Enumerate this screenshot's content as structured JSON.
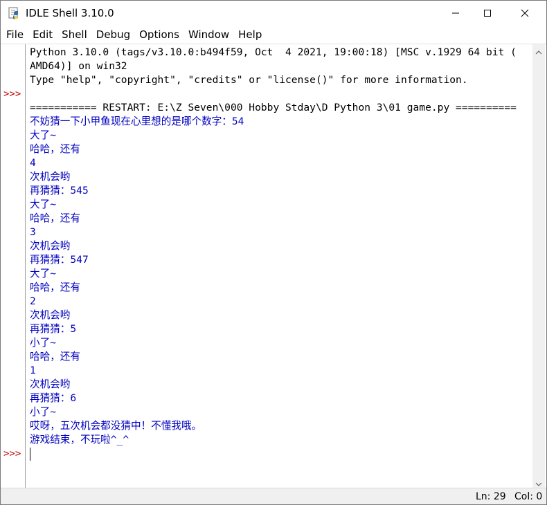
{
  "window": {
    "title": "IDLE Shell 3.10.0"
  },
  "menu": {
    "items": [
      "File",
      "Edit",
      "Shell",
      "Debug",
      "Options",
      "Window",
      "Help"
    ]
  },
  "gutter": {
    "prompt": ">>>"
  },
  "shell": {
    "lines": [
      {
        "text": "Python 3.10.0 (tags/v3.10.0:b494f59, Oct  4 2021, 19:00:18) [MSC v.1929 64 bit (",
        "kind": "stdout-black"
      },
      {
        "text": "AMD64)] on win32",
        "kind": "stdout-black"
      },
      {
        "text": "Type \"help\", \"copyright\", \"credits\" or \"license()\" for more information.",
        "kind": "stdout-black"
      },
      {
        "text": "",
        "kind": "stdout-black"
      },
      {
        "text": "=========== RESTART: E:\\Z Seven\\000 Hobby Stday\\D Python 3\\01 game.py ==========",
        "kind": "stdout-black"
      },
      {
        "text": "不妨猜一下小甲鱼现在心里想的是哪个数字：54",
        "kind": "out"
      },
      {
        "text": "大了~",
        "kind": "out"
      },
      {
        "text": "哈哈，还有",
        "kind": "out"
      },
      {
        "text": "4",
        "kind": "out"
      },
      {
        "text": "次机会哟",
        "kind": "out"
      },
      {
        "text": "再猜猜：545",
        "kind": "out"
      },
      {
        "text": "大了~",
        "kind": "out"
      },
      {
        "text": "哈哈，还有",
        "kind": "out"
      },
      {
        "text": "3",
        "kind": "out"
      },
      {
        "text": "次机会哟",
        "kind": "out"
      },
      {
        "text": "再猜猜：547",
        "kind": "out"
      },
      {
        "text": "大了~",
        "kind": "out"
      },
      {
        "text": "哈哈，还有",
        "kind": "out"
      },
      {
        "text": "2",
        "kind": "out"
      },
      {
        "text": "次机会哟",
        "kind": "out"
      },
      {
        "text": "再猜猜：5",
        "kind": "out"
      },
      {
        "text": "小了~",
        "kind": "out"
      },
      {
        "text": "哈哈，还有",
        "kind": "out"
      },
      {
        "text": "1",
        "kind": "out"
      },
      {
        "text": "次机会哟",
        "kind": "out"
      },
      {
        "text": "再猜猜：6",
        "kind": "out"
      },
      {
        "text": "小了~",
        "kind": "out"
      },
      {
        "text": "哎呀，五次机会都没猜中！不懂我哦。",
        "kind": "out"
      },
      {
        "text": "游戏结束，不玩啦^_^",
        "kind": "out"
      },
      {
        "text": "",
        "kind": "input"
      }
    ]
  },
  "status": {
    "ln": "Ln: 29",
    "col": "Col: 0"
  },
  "colors": {
    "prompt": "#c00000",
    "stdout": "#0000c0",
    "text": "#000000"
  },
  "icons": {
    "app": "python-idle-icon",
    "minimize": "minimize-icon",
    "maximize": "maximize-icon",
    "close": "close-icon",
    "scroll_up": "arrow-up-icon",
    "scroll_down": "arrow-down-icon"
  }
}
